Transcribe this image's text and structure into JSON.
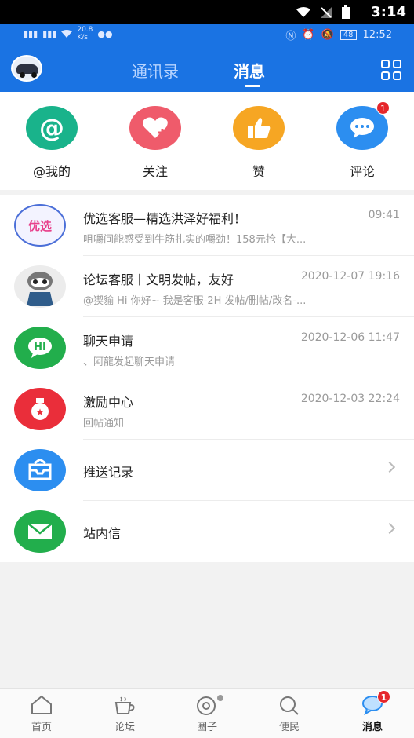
{
  "system_bar": {
    "time": "3:14"
  },
  "status_line": {
    "speed": "20.8",
    "speed_unit": "K/s",
    "battery": "48",
    "clock": "12:52"
  },
  "header": {
    "tabs": [
      {
        "label": "通讯录",
        "active": false
      },
      {
        "label": "消息",
        "active": true
      }
    ]
  },
  "quick_actions": [
    {
      "label": "@我的",
      "icon": "at-icon",
      "color": "#19b38b"
    },
    {
      "label": "关注",
      "icon": "heart-plus-icon",
      "color": "#ef5b6b"
    },
    {
      "label": "赞",
      "icon": "thumbs-up-icon",
      "color": "#f6a623"
    },
    {
      "label": "评论",
      "icon": "chat-bubble-icon",
      "color": "#2c8ef0",
      "badge": "1"
    }
  ],
  "messages": [
    {
      "title": "优选客服—精选洪泽好福利！",
      "time": "09:41",
      "preview": "咀嚼间能感受到牛筋扎实的嚼劲！158元抢【大...",
      "avatar": "promo-avatar"
    },
    {
      "title": "论坛客服丨文明发帖，友好",
      "time": "2020-12-07 19:16",
      "preview": "@猰貐 Hi 你好~ 我是客服-2H 发帖/删帖/改名-...",
      "avatar": "raccoon-avatar"
    },
    {
      "title": "聊天申请",
      "time": "2020-12-06 11:47",
      "preview": "、阿龍发起聊天申请",
      "avatar": "hi-icon"
    },
    {
      "title": "激励中心",
      "time": "2020-12-03 22:24",
      "preview": "回帖通知",
      "avatar": "incentive-icon"
    }
  ],
  "links": [
    {
      "label": "推送记录",
      "icon": "inbox-icon",
      "color": "#2c8ef0"
    },
    {
      "label": "站内信",
      "icon": "envelope-icon",
      "color": "#22ae4c"
    }
  ],
  "bottom_nav": [
    {
      "label": "首页",
      "icon": "home-icon",
      "active": false
    },
    {
      "label": "论坛",
      "icon": "coffee-icon",
      "active": false
    },
    {
      "label": "圈子",
      "icon": "circle-icon",
      "active": false,
      "dot": true
    },
    {
      "label": "便民",
      "icon": "search-icon",
      "active": false
    },
    {
      "label": "消息",
      "icon": "message-icon",
      "active": true,
      "badge": "1"
    }
  ]
}
